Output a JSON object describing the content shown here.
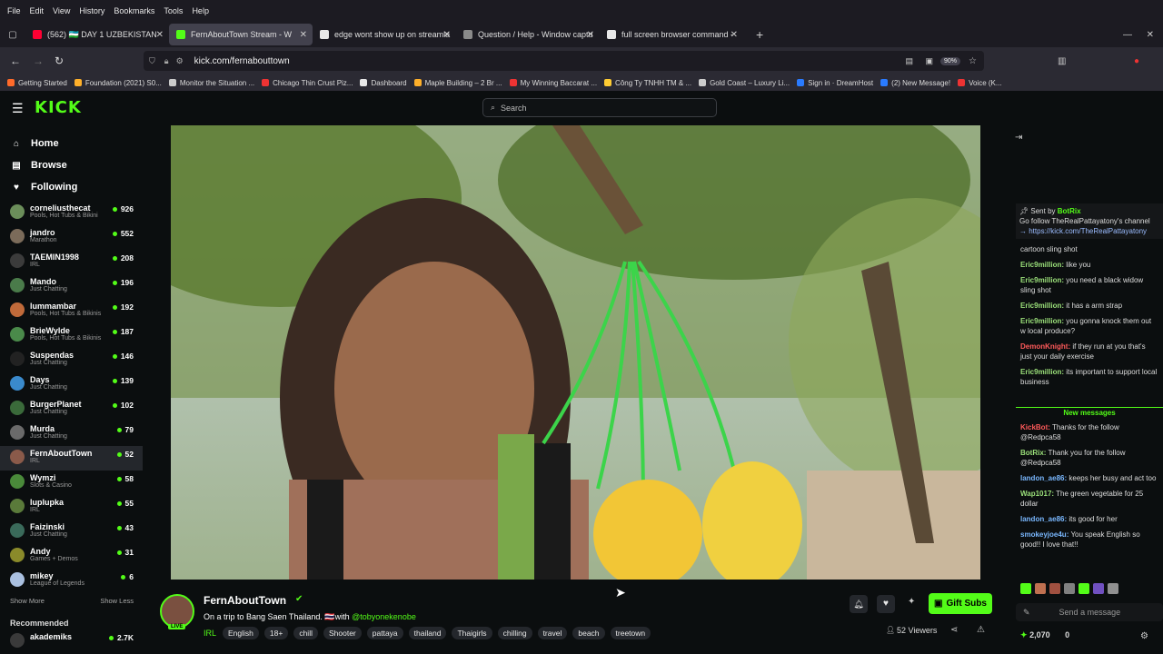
{
  "browser": {
    "menu": [
      "File",
      "Edit",
      "View",
      "History",
      "Bookmarks",
      "Tools",
      "Help"
    ],
    "tabs": [
      {
        "label": "(562) 🇺🇿 DAY 1 UZBEKISTAN",
        "color": "#ff0033",
        "active": false
      },
      {
        "label": "FernAboutTown Stream - W",
        "color": "#53fc18",
        "active": true
      },
      {
        "label": "edge wont show up on streamla",
        "color": "#e8e8e8",
        "active": false
      },
      {
        "label": "Question / Help - Window captu",
        "color": "#8a8a8a",
        "active": false
      },
      {
        "label": "full screen browser command -",
        "color": "#e8e8e8",
        "active": false
      }
    ],
    "url": "kick.com/fernabouttown",
    "zoom": "90%",
    "bookmarks": [
      {
        "label": "Getting Started",
        "color": "#ff6a2a"
      },
      {
        "label": "Foundation (2021) S0...",
        "color": "#ffb02a"
      },
      {
        "label": "Monitor the Situation ...",
        "color": "#ccc"
      },
      {
        "label": "Chicago Thin Crust Piz...",
        "color": "#e33"
      },
      {
        "label": "Dashboard",
        "color": "#e8e8e8"
      },
      {
        "label": "Maple Building – 2 Br ...",
        "color": "#ffb02a"
      },
      {
        "label": "My Winning Baccarat ...",
        "color": "#e33"
      },
      {
        "label": "Công Ty TNHH TM & ...",
        "color": "#ffcc33"
      },
      {
        "label": "Gold Coast – Luxury Li...",
        "color": "#ccc"
      },
      {
        "label": "Sign in · DreamHost",
        "color": "#2a7bff"
      },
      {
        "label": "(2) New Message!",
        "color": "#2a7bff"
      },
      {
        "label": "Voice (K...",
        "color": "#e33"
      }
    ]
  },
  "kick": {
    "logo": "KICK",
    "search_placeholder": "Search",
    "nav": [
      {
        "label": "Home",
        "icon": "home-icon"
      },
      {
        "label": "Browse",
        "icon": "browse-icon"
      },
      {
        "label": "Following",
        "icon": "heart-icon"
      }
    ],
    "following": [
      {
        "name": "corneliusthecat",
        "category": "Pools, Hot Tubs & Bikini",
        "viewers": "926",
        "color": "#6b8e5a"
      },
      {
        "name": "jandro",
        "category": "Marathon",
        "viewers": "552",
        "color": "#7b6b5a"
      },
      {
        "name": "TAEMIN1998",
        "category": "IRL",
        "viewers": "208",
        "color": "#3b3b3b"
      },
      {
        "name": "Mando",
        "category": "Just Chatting",
        "viewers": "196",
        "color": "#4a7b4a"
      },
      {
        "name": "lummambar",
        "category": "Pools, Hot Tubs & Bikinis",
        "viewers": "192",
        "color": "#c06a3a"
      },
      {
        "name": "BrieWylde",
        "category": "Pools, Hot Tubs & Bikinis",
        "viewers": "187",
        "color": "#4a8a4a"
      },
      {
        "name": "Suspendas",
        "category": "Just Chatting",
        "viewers": "146",
        "color": "#222"
      },
      {
        "name": "Days",
        "category": "Just Chatting",
        "viewers": "139",
        "color": "#3a8acc"
      },
      {
        "name": "BurgerPlanet",
        "category": "Just Chatting",
        "viewers": "102",
        "color": "#3a6a3a"
      },
      {
        "name": "Murda",
        "category": "Just Chatting",
        "viewers": "79",
        "color": "#6a6a6a"
      },
      {
        "name": "FernAboutTown",
        "category": "IRL",
        "viewers": "52",
        "color": "#8a5a4a"
      },
      {
        "name": "Wymzi",
        "category": "Slots & Casino",
        "viewers": "58",
        "color": "#4a8a3a"
      },
      {
        "name": "luplupka",
        "category": "IRL",
        "viewers": "55",
        "color": "#5a7a3a"
      },
      {
        "name": "Faizinski",
        "category": "Just Chatting",
        "viewers": "43",
        "color": "#3a6a5a"
      },
      {
        "name": "Andy",
        "category": "Games + Demos",
        "viewers": "31",
        "color": "#8a8a2a"
      },
      {
        "name": "mikey",
        "category": "League of Legends",
        "viewers": "6",
        "color": "#aac0e0"
      }
    ],
    "show_more": "Show More",
    "show_less": "Show Less",
    "recommended_label": "Recommended",
    "recommended": [
      {
        "name": "akademiks",
        "viewers": "2.7K",
        "color": "#3a3a3a"
      }
    ],
    "stream": {
      "streamer": "FernAboutTown",
      "title_prefix": "On a trip to Bang Saen Thailand. 🇹🇭with ",
      "title_mention": "@tobyonekenobe",
      "live_badge": "LIVE",
      "category": "IRL",
      "tags": [
        "English",
        "18+",
        "chill",
        "Shooter",
        "pattaya",
        "thailand",
        "Thaigirls",
        "chilling",
        "travel",
        "beach",
        "treetown"
      ],
      "gift_label": "Gift Subs",
      "viewers_label": "52 Viewers"
    },
    "chat": {
      "pinned_sender_prefix": "Sent by",
      "pinned_sender": "BotRix",
      "pinned_text": "Go follow TheRealPattayatony's channel",
      "pinned_link": "→ https://kick.com/TheRealPattayatony",
      "new_messages": "New messages",
      "input_placeholder": "Send a message",
      "points": "2,070",
      "points2": "0",
      "messages_top": [
        {
          "user": "",
          "text": "cartoon sling shot",
          "cls": ""
        },
        {
          "user": "Eric9million:",
          "text": " like you",
          "cls": ""
        },
        {
          "user": "Eric9million:",
          "text": " you need a black widow sling shot",
          "cls": ""
        },
        {
          "user": "Eric9million:",
          "text": " it has a arm strap",
          "cls": ""
        },
        {
          "user": "Eric9million:",
          "text": " you gonna knock them out w local produce?",
          "cls": ""
        },
        {
          "user": "DemonKnight:",
          "text": " if they run at you that's just your daily exercise",
          "cls": "red"
        },
        {
          "user": "Eric9million:",
          "text": " its important to support local business",
          "cls": ""
        }
      ],
      "messages_bottom": [
        {
          "user": "KickBot:",
          "text": " Thanks for the follow @Redpca58",
          "cls": "red"
        },
        {
          "user": "BotRix:",
          "text": " Thank you for the follow @Redpca58",
          "cls": ""
        },
        {
          "user": "landon_ae86:",
          "text": " keeps her busy and act too",
          "cls": "blue"
        },
        {
          "user": "Wap1017:",
          "text": " The green vegetable for 25 dollar",
          "cls": ""
        },
        {
          "user": "landon_ae86:",
          "text": " its good for her",
          "cls": "blue"
        },
        {
          "user": "smokeyjoe4u:",
          "text": " You speak English so good!! I love that!!",
          "cls": "blue"
        }
      ]
    }
  },
  "colors": {
    "accent": "#53fc18",
    "bg": "#0b0e0f"
  }
}
